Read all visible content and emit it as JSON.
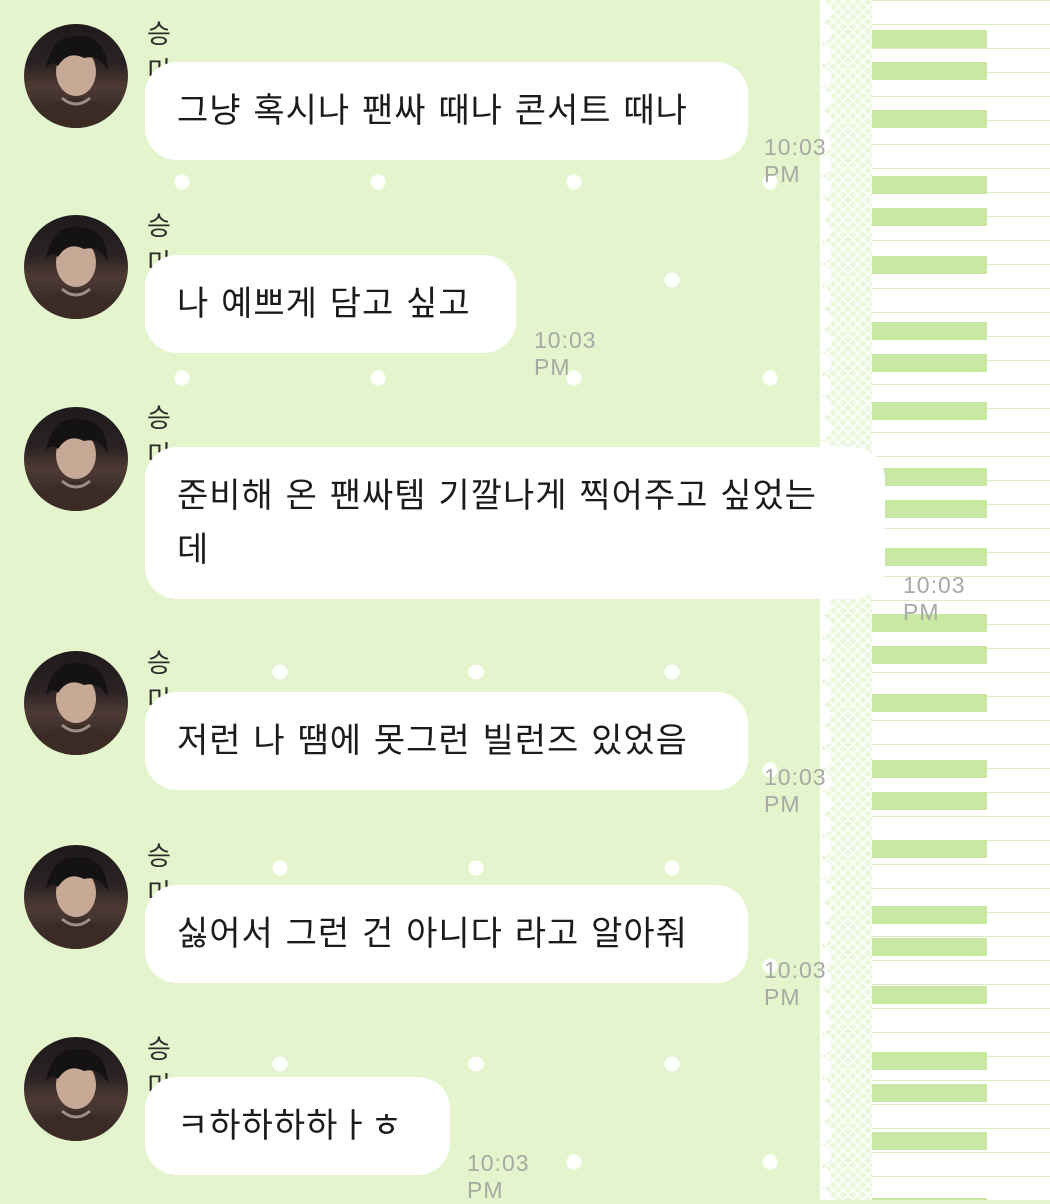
{
  "chat": {
    "messages": [
      {
        "sender": "승미니",
        "text": "그냥 혹시나 팬싸 때나 콘서트 때나",
        "time": "10:03 PM"
      },
      {
        "sender": "승미니",
        "text": "나 예쁘게 담고 싶고",
        "time": "10:03 PM"
      },
      {
        "sender": "승미니",
        "text": "준비해 온 팬싸템 기깔나게 찍어주고 싶었는데",
        "time": "10:03 PM"
      },
      {
        "sender": "승미니",
        "text": "저런 나 땜에 못그런 빌런즈 있었음",
        "time": "10:03 PM"
      },
      {
        "sender": "승미니",
        "text": "싫어서 그런 건 아니다 라고 알아줘",
        "time": "10:03 PM"
      },
      {
        "sender": "승미니",
        "text": "ㅋ하하하하ㅏㅎ",
        "time": "10:03 PM"
      }
    ]
  },
  "colors": {
    "background": "#e4f5cd",
    "bubble": "#ffffff",
    "piano_accent": "#c9e8a3",
    "timestamp": "#a7a9a2"
  }
}
